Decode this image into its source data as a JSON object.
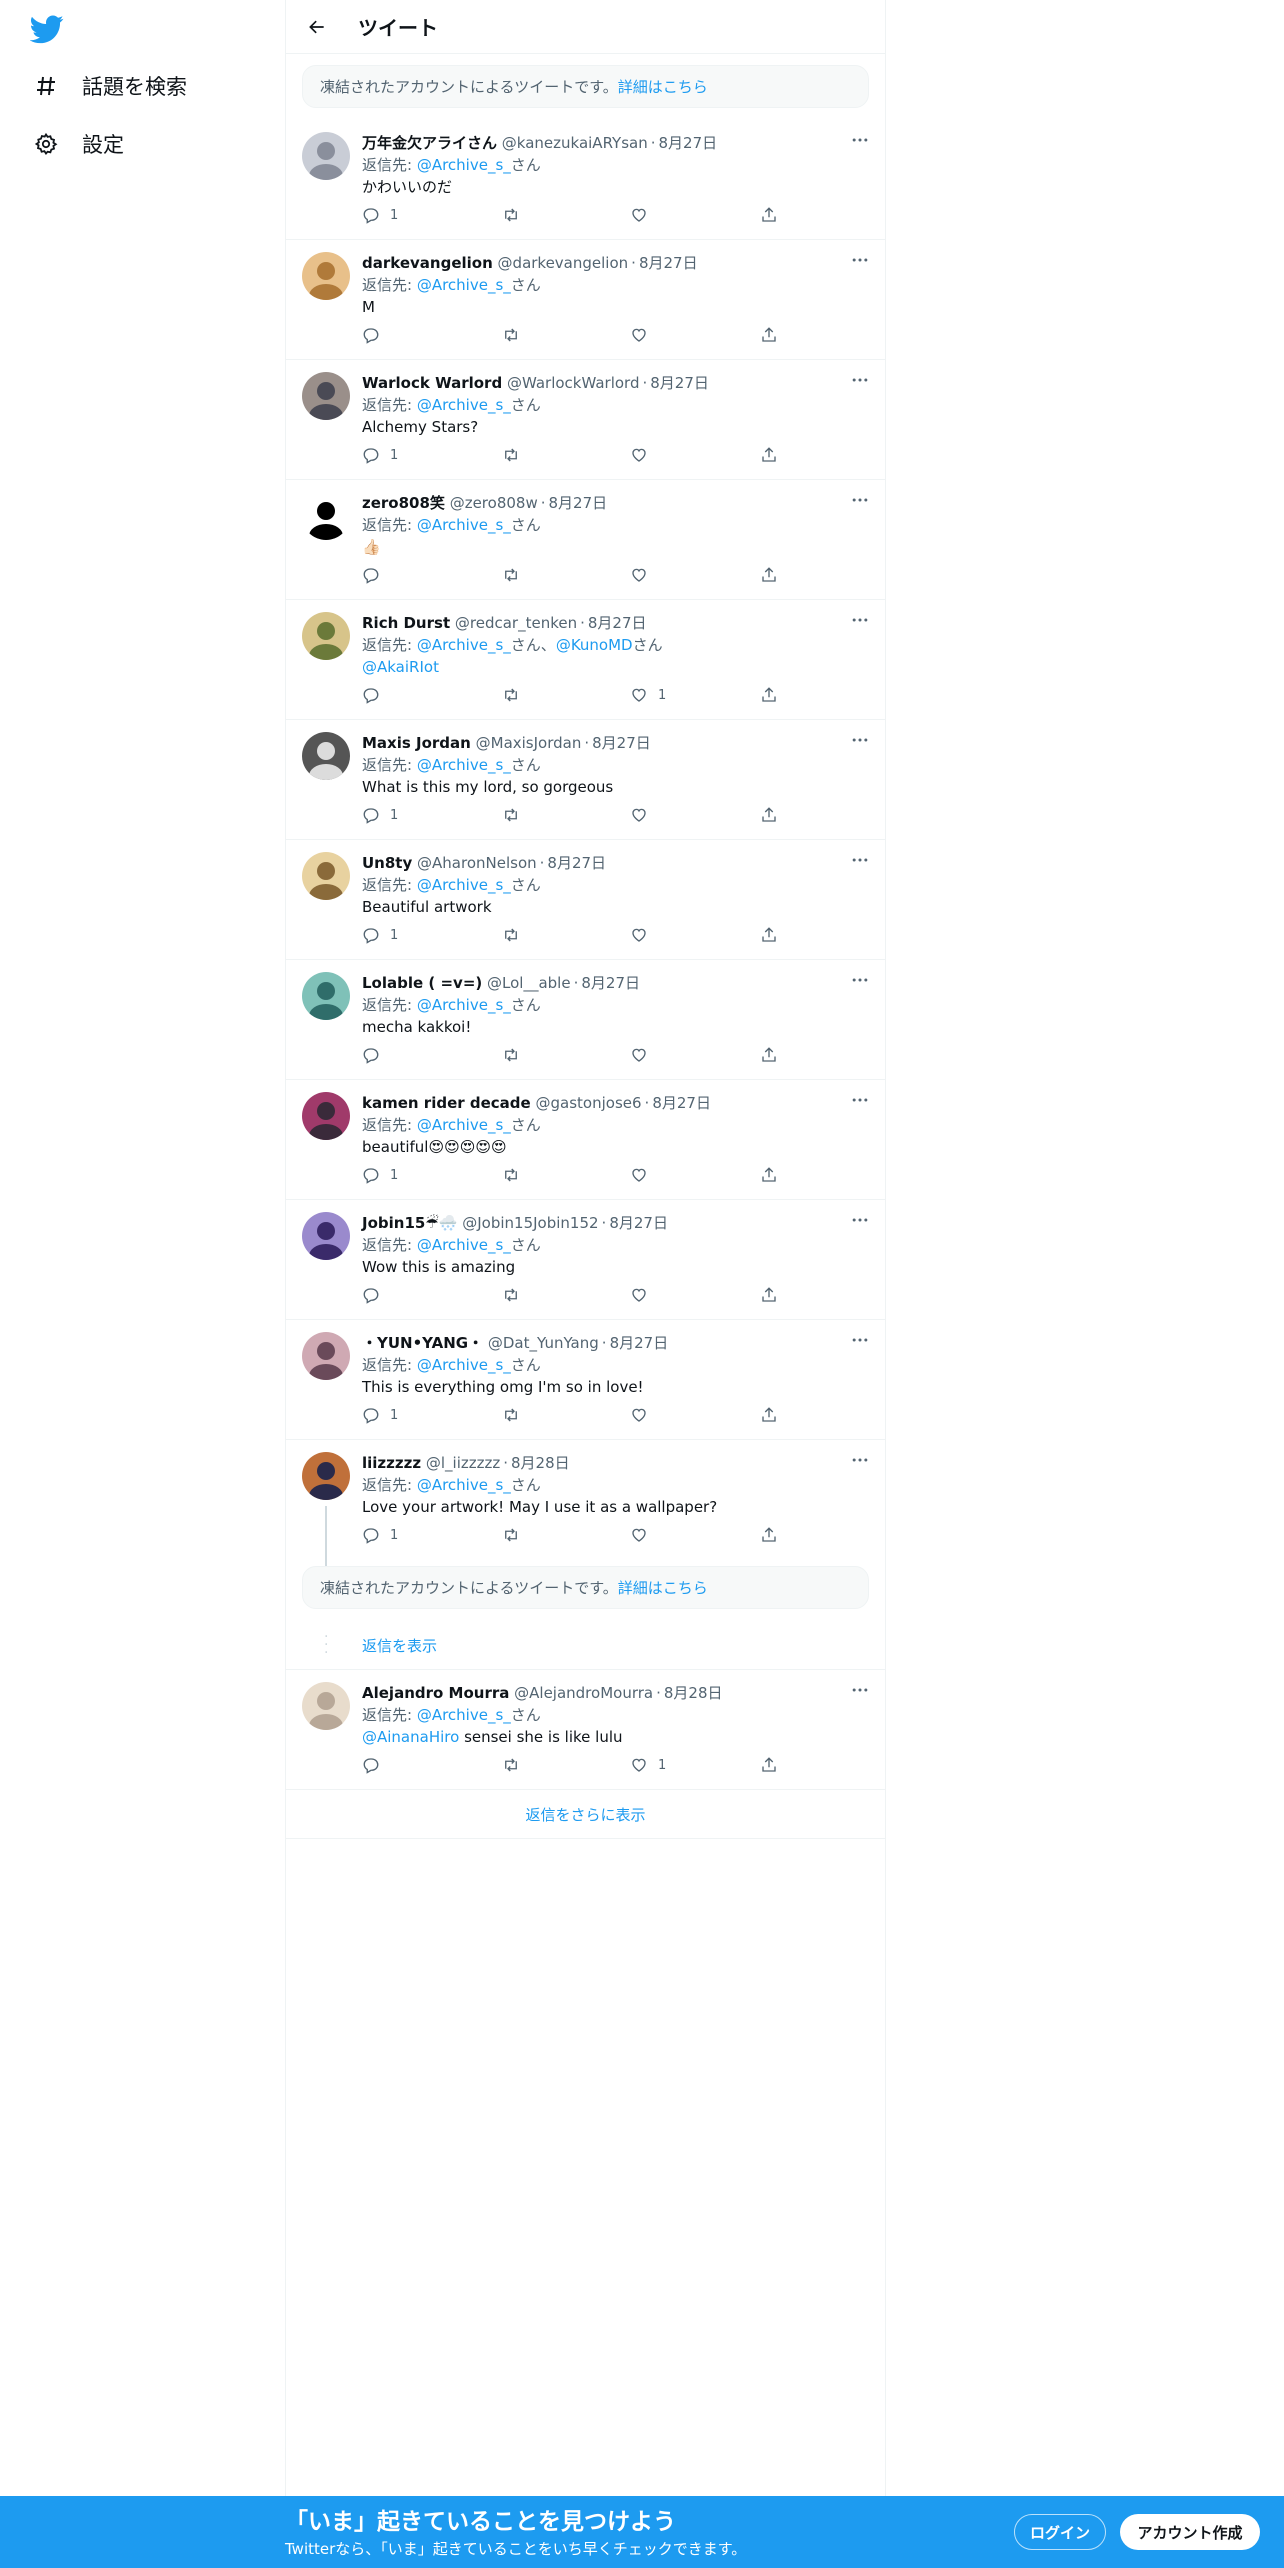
{
  "sidebar": {
    "items": [
      {
        "label": "話題を検索",
        "icon": "hashtag-icon"
      },
      {
        "label": "設定",
        "icon": "gear-icon"
      }
    ]
  },
  "header": {
    "title": "ツイート"
  },
  "notice": {
    "text": "凍結されたアカウントによるツイートです。",
    "link": "詳細はこちら"
  },
  "reply_prefix": "返信先: ",
  "reply_suffix": "さん",
  "tweets": [
    {
      "name": "万年金欠アライさん",
      "handle": "@kanezukaiARYsan",
      "date": "8月27日",
      "reply_to": "@Archive_s_",
      "text": "かわいいのだ",
      "replies": "1",
      "retweets": "",
      "likes": ""
    },
    {
      "name": "darkevangelion",
      "handle": "@darkevangelion",
      "date": "8月27日",
      "reply_to": "@Archive_s_",
      "text": "M",
      "replies": "",
      "retweets": "",
      "likes": ""
    },
    {
      "name": "Warlock Warlord",
      "handle": "@WarlockWarlord",
      "date": "8月27日",
      "reply_to": "@Archive_s_",
      "text": "Alchemy Stars?",
      "replies": "1",
      "retweets": "",
      "likes": ""
    },
    {
      "name": "zero808笑",
      "handle": "@zero808w",
      "date": "8月27日",
      "reply_to": "@Archive_s_",
      "text": "👍🏻",
      "replies": "",
      "retweets": "",
      "likes": ""
    },
    {
      "name": "Rich Durst",
      "handle": "@redcar_tenken",
      "date": "8月27日",
      "reply_to": "@Archive_s_",
      "reply_to2": "@KunoMD",
      "text_link": "@AkaiRIot",
      "text": "",
      "replies": "",
      "retweets": "",
      "likes": "1"
    },
    {
      "name": "Maxis Jordan",
      "handle": "@MaxisJordan",
      "date": "8月27日",
      "reply_to": "@Archive_s_",
      "text": "What is this my lord, so gorgeous",
      "replies": "1",
      "retweets": "",
      "likes": ""
    },
    {
      "name": "Un8ty",
      "handle": "@AharonNelson",
      "date": "8月27日",
      "reply_to": "@Archive_s_",
      "text": "Beautiful artwork",
      "replies": "1",
      "retweets": "",
      "likes": ""
    },
    {
      "name": "Lolable ( =v=)",
      "handle": "@Lol__able",
      "date": "8月27日",
      "reply_to": "@Archive_s_",
      "text": "mecha kakkoi!",
      "replies": "",
      "retweets": "",
      "likes": ""
    },
    {
      "name": "kamen rider decade",
      "handle": "@gastonjose6",
      "date": "8月27日",
      "reply_to": "@Archive_s_",
      "text": "beautiful😍😍😍😍😍",
      "replies": "1",
      "retweets": "",
      "likes": ""
    },
    {
      "name": "Jobin15☔🌨️",
      "handle": "@Jobin15Jobin152",
      "date": "8月27日",
      "reply_to": "@Archive_s_",
      "text": "Wow this is amazing",
      "replies": "",
      "retweets": "",
      "likes": ""
    },
    {
      "name": "・YUN•YANG・",
      "handle": "@Dat_YunYang",
      "date": "8月27日",
      "reply_to": "@Archive_s_",
      "text": "This is everything omg I'm so in love!",
      "replies": "1",
      "retweets": "",
      "likes": ""
    },
    {
      "name": "liizzzzz",
      "handle": "@l_iizzzzz",
      "date": "8月28日",
      "reply_to": "@Archive_s_",
      "text": "Love your artwork! May I use it as a wallpaper?",
      "replies": "1",
      "retweets": "",
      "likes": ""
    }
  ],
  "notice2": {
    "text": "凍結されたアカウントによるツイートです。",
    "link": "詳細はこちら"
  },
  "show_replies": "返信を表示",
  "last_tweet": {
    "name": "Alejandro Mourra",
    "handle": "@AlejandroMourra",
    "date": "8月28日",
    "reply_to": "@Archive_s_",
    "text_link": "@AinanaHiro",
    "text": " sensei she is like lulu",
    "replies": "",
    "retweets": "",
    "likes": "1"
  },
  "more_replies": "返信をさらに表示",
  "bottom": {
    "title": "「いま」起きていることを見つけよう",
    "subtitle": "Twitterなら、「いま」起きていることをいち早くチェックできます。",
    "login": "ログイン",
    "signup": "アカウント作成"
  },
  "colors": {
    "accent": "#1d9bf0",
    "secondary_text": "#536471",
    "border": "#eff3f4"
  }
}
